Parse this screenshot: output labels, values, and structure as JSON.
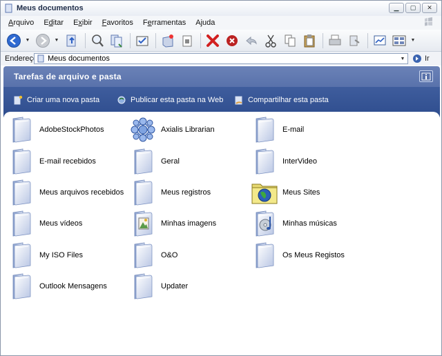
{
  "window": {
    "title": "Meus documentos",
    "controls": [
      "minimize",
      "maximize",
      "close"
    ]
  },
  "menu": [
    {
      "label": "Arquivo",
      "accel": "A"
    },
    {
      "label": "Editar",
      "accel": "d"
    },
    {
      "label": "Exibir",
      "accel": "x"
    },
    {
      "label": "Favoritos",
      "accel": "F"
    },
    {
      "label": "Ferramentas",
      "accel": "e"
    },
    {
      "label": "Ajuda",
      "accel": "j"
    }
  ],
  "toolbar": {
    "buttons": [
      "back-icon",
      "forward-icon",
      "up-folder-icon",
      "search-icon",
      "folders-icon",
      "sync-icon",
      "new-folder-icon",
      "properties-icon",
      "delete-icon",
      "stop-icon",
      "undo-icon",
      "cut-icon",
      "copy-icon",
      "paste-icon",
      "print-icon",
      "refresh-icon",
      "map-drive-icon",
      "views-icon"
    ]
  },
  "address": {
    "label": "Endereço",
    "value": "Meus documentos",
    "go_label": "Ir"
  },
  "tasks": {
    "title": "Tarefas de arquivo e pasta",
    "links": [
      {
        "label": "Criar uma nova pasta",
        "icon": "new-folder-icon"
      },
      {
        "label": "Publicar esta pasta na Web",
        "icon": "publish-web-icon"
      },
      {
        "label": "Compartilhar esta pasta",
        "icon": "share-folder-icon"
      }
    ]
  },
  "folders": [
    {
      "name": "AdobeStockPhotos",
      "icon": "folder-icon"
    },
    {
      "name": "Axialis Librarian",
      "icon": "molecule-icon"
    },
    {
      "name": "E-mail",
      "icon": "folder-icon"
    },
    {
      "name": "E-mail recebidos",
      "icon": "folder-icon"
    },
    {
      "name": "Geral",
      "icon": "folder-icon"
    },
    {
      "name": "InterVideo",
      "icon": "folder-icon"
    },
    {
      "name": "Meus arquivos recebidos",
      "icon": "folder-icon"
    },
    {
      "name": "Meus registros",
      "icon": "folder-icon"
    },
    {
      "name": "Meus Sites",
      "icon": "globe-folder-icon"
    },
    {
      "name": "Meus vídeos",
      "icon": "folder-icon"
    },
    {
      "name": "Minhas imagens",
      "icon": "pictures-folder-icon"
    },
    {
      "name": "Minhas músicas",
      "icon": "music-folder-icon"
    },
    {
      "name": "My ISO Files",
      "icon": "folder-icon"
    },
    {
      "name": "O&O",
      "icon": "folder-icon"
    },
    {
      "name": "Os Meus Registos",
      "icon": "folder-icon"
    },
    {
      "name": "Outlook Mensagens",
      "icon": "folder-icon"
    },
    {
      "name": "Updater",
      "icon": "folder-icon"
    }
  ]
}
